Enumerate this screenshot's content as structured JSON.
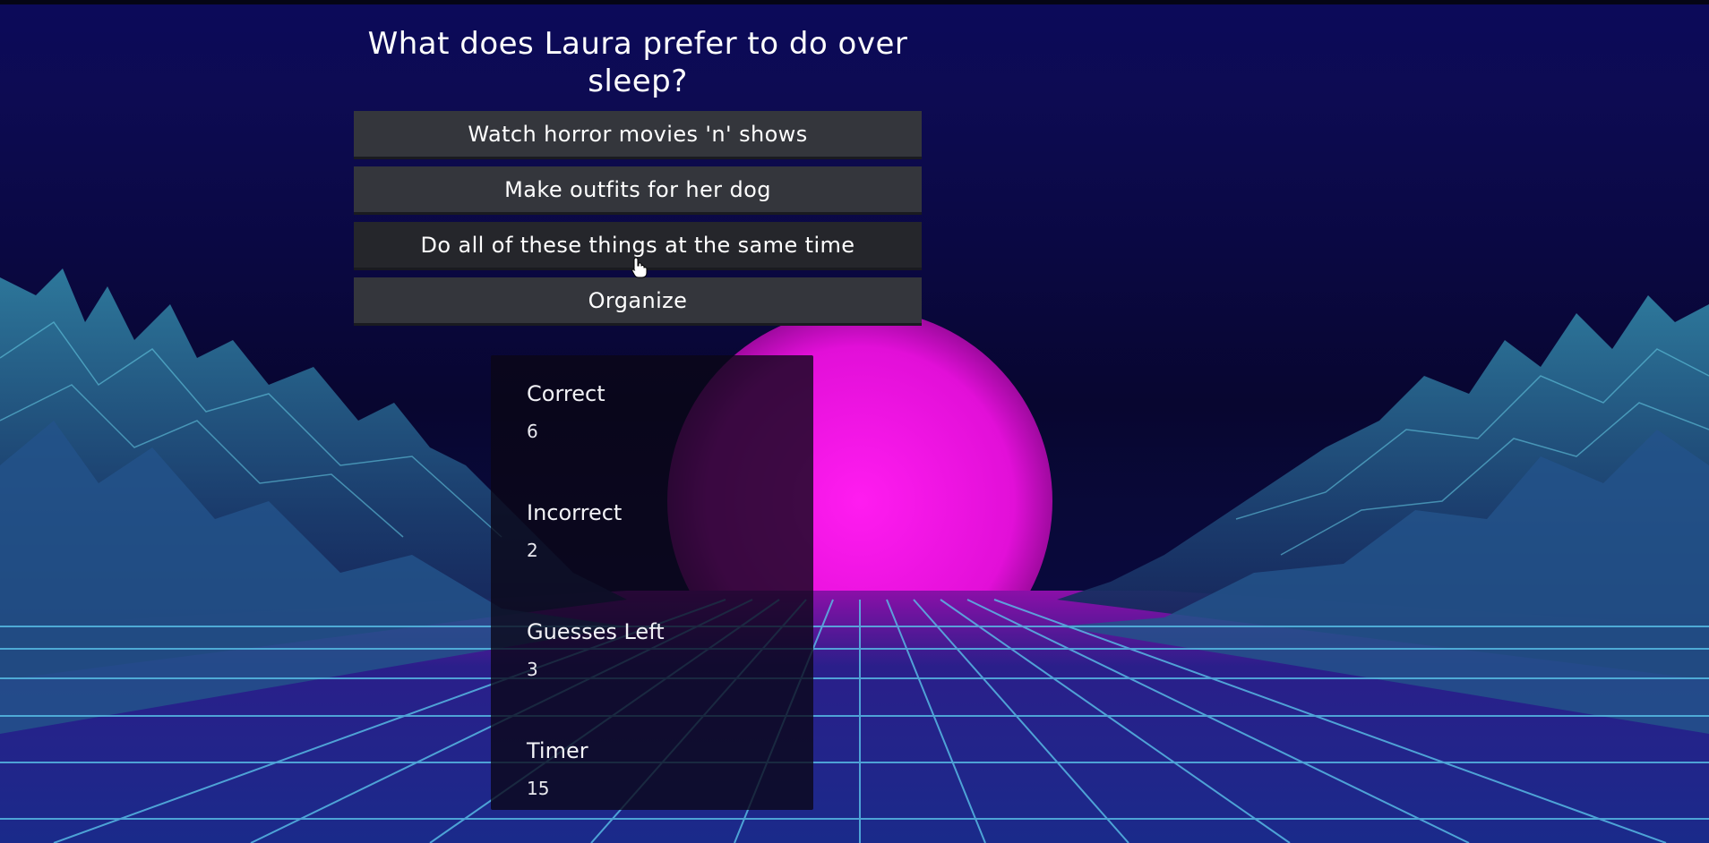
{
  "question": {
    "text": "What does Laura prefer to do over sleep?"
  },
  "answers": [
    {
      "label": "Watch horror movies 'n' shows"
    },
    {
      "label": "Make outfits for her dog"
    },
    {
      "label": "Do all of these things at the same time"
    },
    {
      "label": "Organize"
    }
  ],
  "stats": {
    "correct": {
      "label": "Correct",
      "value": "6"
    },
    "incorrect": {
      "label": "Incorrect",
      "value": "2"
    },
    "guesses_left": {
      "label": "Guesses Left",
      "value": "3"
    },
    "timer": {
      "label": "Timer",
      "value": "15"
    }
  },
  "colors": {
    "sky": "#0c0a5a",
    "sun": "#e010d8",
    "grid": "#4fb6e0",
    "button": "#34363c"
  },
  "icons": {
    "cursor": "hand-pointer-icon"
  }
}
